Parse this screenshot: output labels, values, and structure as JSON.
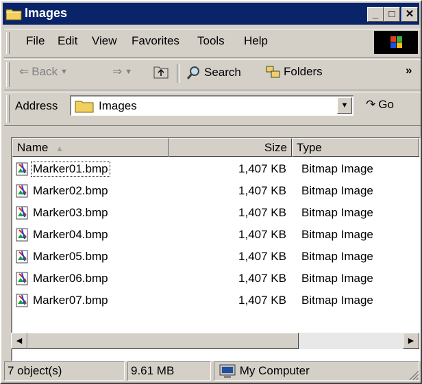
{
  "window": {
    "title": "Images"
  },
  "menu": {
    "items": [
      {
        "label": "File"
      },
      {
        "label": "Edit"
      },
      {
        "label": "View"
      },
      {
        "label": "Favorites"
      },
      {
        "label": "Tools"
      },
      {
        "label": "Help"
      }
    ]
  },
  "toolbar": {
    "back_label": "Back",
    "search_label": "Search",
    "folders_label": "Folders",
    "more_label": "»"
  },
  "address": {
    "label": "Address",
    "value": "Images",
    "go_label": "Go"
  },
  "list": {
    "columns": [
      {
        "label": "Name"
      },
      {
        "label": "Size"
      },
      {
        "label": "Type"
      }
    ],
    "files": [
      {
        "name": "Marker01.bmp",
        "size": "1,407 KB",
        "type": "Bitmap Image"
      },
      {
        "name": "Marker02.bmp",
        "size": "1,407 KB",
        "type": "Bitmap Image"
      },
      {
        "name": "Marker03.bmp",
        "size": "1,407 KB",
        "type": "Bitmap Image"
      },
      {
        "name": "Marker04.bmp",
        "size": "1,407 KB",
        "type": "Bitmap Image"
      },
      {
        "name": "Marker05.bmp",
        "size": "1,407 KB",
        "type": "Bitmap Image"
      },
      {
        "name": "Marker06.bmp",
        "size": "1,407 KB",
        "type": "Bitmap Image"
      },
      {
        "name": "Marker07.bmp",
        "size": "1,407 KB",
        "type": "Bitmap Image"
      }
    ]
  },
  "status": {
    "objects": "7 object(s)",
    "size": "9.61 MB",
    "zone": "My Computer"
  },
  "colors": {
    "titlebar": "#0a246a",
    "face": "#d4d0c8"
  }
}
